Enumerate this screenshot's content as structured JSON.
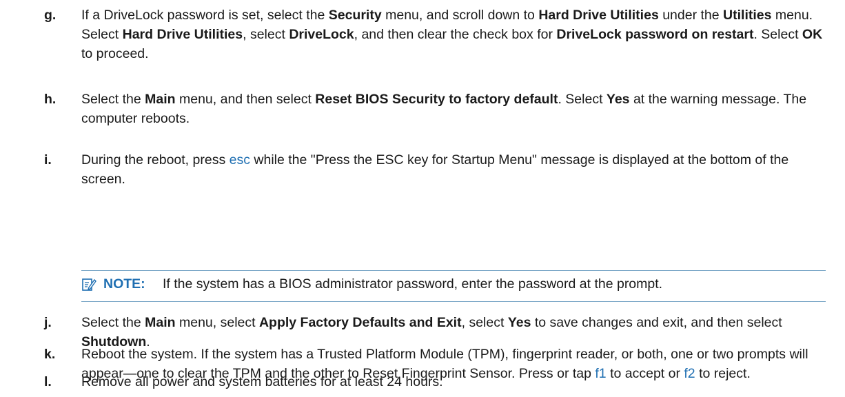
{
  "steps": {
    "g": {
      "letter": "g.",
      "t1": "If a DriveLock password is set, select the ",
      "b1": "Security",
      "t2": " menu, and scroll down to ",
      "b2": "Hard Drive Utilities",
      "t3": " under the ",
      "b3": "Utilities",
      "t4": " menu. Select ",
      "b4": "Hard Drive Utilities",
      "t5": ", select ",
      "b5": "DriveLock",
      "t6": ", and then clear the check box for ",
      "b6": "DriveLock password on restart",
      "t7": ". Select ",
      "b7": "OK",
      "t8": " to proceed."
    },
    "h": {
      "letter": "h.",
      "t1": "Select the ",
      "b1": "Main",
      "t2": " menu, and then select ",
      "b2": "Reset BIOS Security to factory default",
      "t3": ". Select ",
      "b3": "Yes",
      "t4": " at the warning message. The computer reboots."
    },
    "i": {
      "letter": "i.",
      "t1": "During the reboot, press ",
      "k1": "esc",
      "t2": " while the \"Press the ESC key for Startup Menu\" message is displayed at the bottom of the screen."
    },
    "j": {
      "letter": "j.",
      "t1": "Select the ",
      "b1": "Main",
      "t2": " menu, select ",
      "b2": "Apply Factory Defaults and Exit",
      "t3": ", select ",
      "b3": "Yes",
      "t4": " to save changes and exit, and then select ",
      "b4": "Shutdown",
      "t5": "."
    },
    "k": {
      "letter": "k.",
      "t1": "Reboot the system. If the system has a Trusted Platform Module (TPM), fingerprint reader, or both, one or two prompts will appear—one to clear the TPM and the other to Reset Fingerprint Sensor. Press or tap ",
      "k1": "f1",
      "t2": " to accept or ",
      "k2": "f2",
      "t3": " to reject."
    },
    "l": {
      "letter": "l.",
      "t1": "Remove all power and system batteries for at least 24 hours."
    }
  },
  "note": {
    "label": "NOTE:",
    "text": "If the system has a BIOS administrator password, enter the password at the prompt.",
    "icon": "note-pencil-icon"
  },
  "colors": {
    "accent": "#1f6fb2",
    "rule": "#7aa7c7",
    "text": "#1a1a1a"
  }
}
